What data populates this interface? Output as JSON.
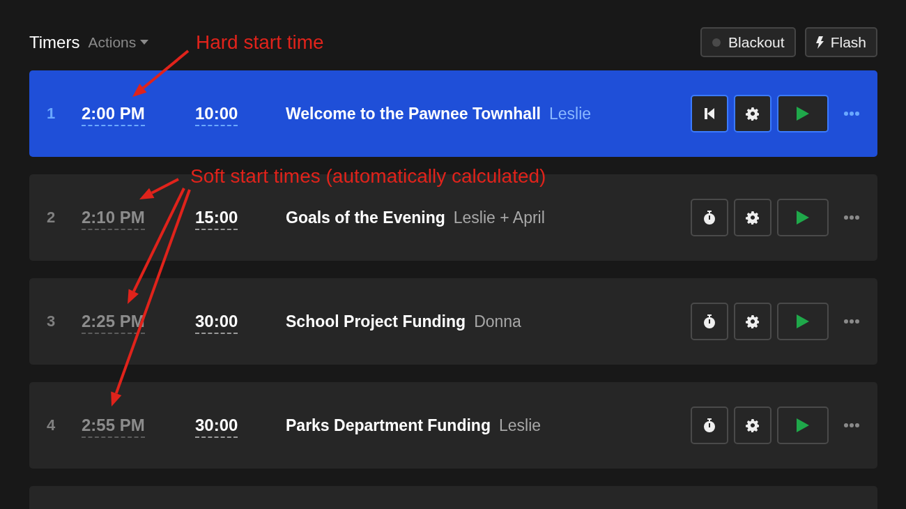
{
  "header": {
    "title": "Timers",
    "actions_menu": "Actions",
    "buttons": [
      {
        "kind": "blackout",
        "label": "Blackout"
      },
      {
        "kind": "flash",
        "label": "Flash"
      }
    ]
  },
  "rows": [
    {
      "number": "1",
      "start_time": "2:00 PM",
      "hard_start": true,
      "duration": "10:00",
      "title": "Welcome to the Pawnee Townhall",
      "speaker": "Leslie",
      "selected": true
    },
    {
      "number": "2",
      "start_time": "2:10 PM",
      "hard_start": false,
      "duration": "15:00",
      "title": "Goals of the Evening",
      "speaker": "Leslie + April",
      "selected": false
    },
    {
      "number": "3",
      "start_time": "2:25 PM",
      "hard_start": false,
      "duration": "30:00",
      "title": "School Project Funding",
      "speaker": "Donna",
      "selected": false
    },
    {
      "number": "4",
      "start_time": "2:55 PM",
      "hard_start": false,
      "duration": "30:00",
      "title": "Parks Department Funding",
      "speaker": "Leslie",
      "selected": false
    }
  ],
  "annotations": [
    {
      "text": "Hard start time"
    },
    {
      "text": "Soft start times (automatically calculated)"
    }
  ]
}
